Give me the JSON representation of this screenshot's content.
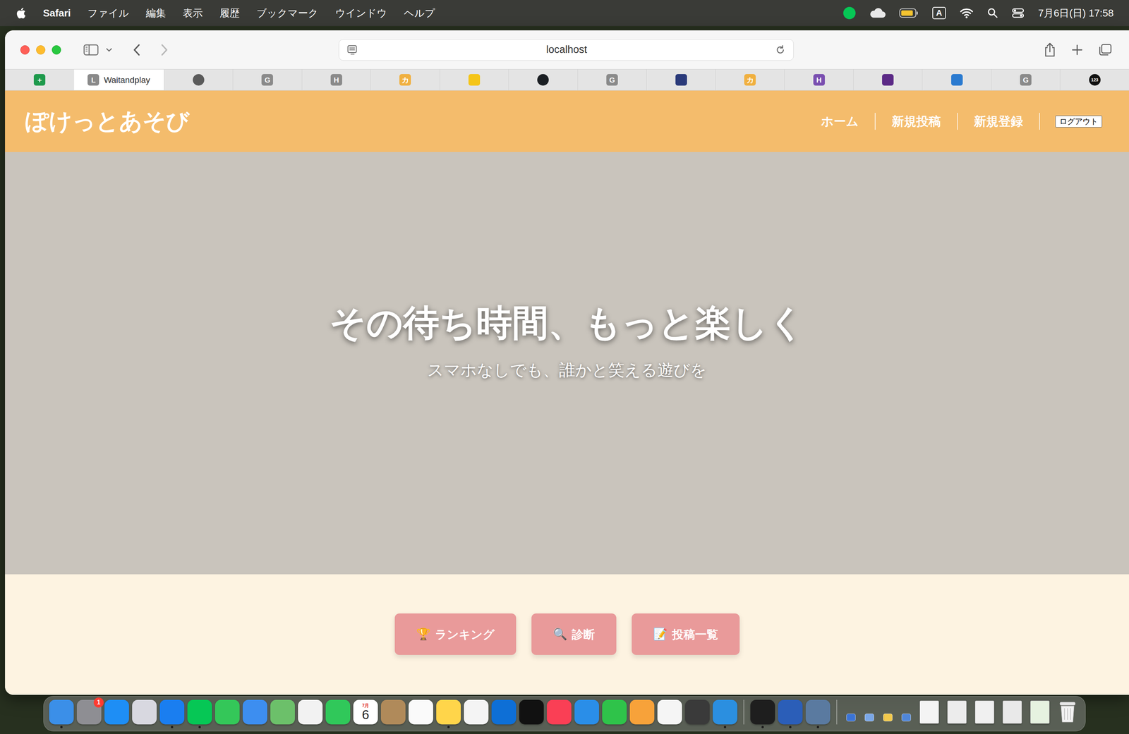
{
  "menubar": {
    "app": "Safari",
    "menus": [
      "ファイル",
      "編集",
      "表示",
      "履歴",
      "ブックマーク",
      "ウインドウ",
      "ヘルプ"
    ],
    "input_source": "A",
    "clock": "7月6日(日) 17:58"
  },
  "browser": {
    "url": "localhost",
    "tabs": [
      {
        "kind": "square",
        "icon": "+",
        "selected": false,
        "color": "#1e9a4c"
      },
      {
        "kind": "square",
        "icon": "L",
        "label": "Waitandplay",
        "selected": true,
        "color": "#8a8a8a"
      },
      {
        "kind": "circle",
        "selected": false,
        "color": "#5a5a5a"
      },
      {
        "kind": "square",
        "icon": "G",
        "selected": false,
        "color": "#8a8a8a"
      },
      {
        "kind": "square",
        "icon": "H",
        "selected": false,
        "color": "#8a8a8a"
      },
      {
        "kind": "square",
        "icon": "カ",
        "selected": false,
        "color": "#f0b040"
      },
      {
        "kind": "square",
        "selected": false,
        "color": "#f5c518"
      },
      {
        "kind": "circle",
        "selected": false,
        "color": "#1b1f23"
      },
      {
        "kind": "square",
        "icon": "G",
        "selected": false,
        "color": "#8a8a8a"
      },
      {
        "kind": "square",
        "selected": false,
        "color": "#2a3a7a"
      },
      {
        "kind": "square",
        "icon": "カ",
        "selected": false,
        "color": "#f0b040"
      },
      {
        "kind": "square",
        "icon": "H",
        "selected": false,
        "color": "#7a4fb0"
      },
      {
        "kind": "square",
        "selected": false,
        "color": "#5b2a86"
      },
      {
        "kind": "square",
        "selected": false,
        "color": "#2a7ad0"
      },
      {
        "kind": "square",
        "icon": "G",
        "selected": false,
        "color": "#8a8a8a"
      },
      {
        "kind": "circle",
        "icon": "123",
        "selected": false,
        "color": "#111111"
      }
    ]
  },
  "page": {
    "logo": "ぽけっとあそび",
    "nav": [
      {
        "label": "ホーム",
        "kind": "link"
      },
      {
        "label": "新規投稿",
        "kind": "link"
      },
      {
        "label": "新規登録",
        "kind": "link"
      },
      {
        "label": "ログアウト",
        "kind": "button"
      }
    ],
    "hero": {
      "title": "その待ち時間、もっと楽しく",
      "subtitle": "スマホなしでも、誰かと笑える遊びを"
    },
    "actions": [
      {
        "icon": "🏆",
        "label": "ランキング"
      },
      {
        "icon": "🔍",
        "label": "診断"
      },
      {
        "icon": "📝",
        "label": "投稿一覧"
      }
    ]
  },
  "dock": {
    "apps": [
      {
        "kind": "app",
        "color": "#3b8fe8",
        "running": true
      },
      {
        "kind": "app",
        "color": "#8e8e93",
        "running": false,
        "badge": "1"
      },
      {
        "kind": "app",
        "color": "#1e8ef5",
        "running": false
      },
      {
        "kind": "app",
        "color": "#d8d8e0",
        "running": false
      },
      {
        "kind": "app",
        "color": "#1a7ef0",
        "running": true
      },
      {
        "kind": "app",
        "color": "#06c755",
        "running": true
      },
      {
        "kind": "app",
        "color": "#34c759",
        "running": false
      },
      {
        "kind": "app",
        "color": "#3d8ef0",
        "running": false
      },
      {
        "kind": "app",
        "color": "#6cc06a",
        "running": false
      },
      {
        "kind": "app",
        "color": "#f2f2f2",
        "running": false
      },
      {
        "kind": "app",
        "color": "#30c85a",
        "running": false
      },
      {
        "kind": "calendar",
        "color": "#ffffff",
        "running": false,
        "month": "7月",
        "day": "6"
      },
      {
        "kind": "app",
        "color": "#b08a5a",
        "running": false
      },
      {
        "kind": "app",
        "color": "#fafafa",
        "running": false
      },
      {
        "kind": "app",
        "color": "#ffd54a",
        "running": true
      },
      {
        "kind": "app",
        "color": "#f4f4f4",
        "running": false
      },
      {
        "kind": "app",
        "color": "#0e6fd6",
        "running": false
      },
      {
        "kind": "app",
        "color": "#111111",
        "running": false
      },
      {
        "kind": "app",
        "color": "#fa3f55",
        "running": false
      },
      {
        "kind": "app",
        "color": "#2a8ee8",
        "running": false
      },
      {
        "kind": "app",
        "color": "#2fc34a",
        "running": false
      },
      {
        "kind": "app",
        "color": "#f7a23a",
        "running": false
      },
      {
        "kind": "app",
        "color": "#f5f5f5",
        "running": false
      },
      {
        "kind": "app",
        "color": "#3a3a3a",
        "running": false
      },
      {
        "kind": "app",
        "color": "#2b8fe0",
        "running": true
      }
    ],
    "recent": [
      {
        "color": "#1e1e1e",
        "running": true
      },
      {
        "color": "#2b5eb8",
        "running": true
      },
      {
        "color": "#5a7aa0",
        "running": true
      }
    ],
    "windows": [
      {
        "color": "#3a73d6"
      },
      {
        "color": "#7aa7e8"
      },
      {
        "color": "#f2c94c"
      },
      {
        "color": "#4f86d9"
      },
      {
        "color": "#f4f4f4"
      },
      {
        "color": "#ececec"
      },
      {
        "color": "#f0f0f0"
      },
      {
        "color": "#e9e9e9"
      },
      {
        "color": "#e6f2e0"
      }
    ]
  }
}
